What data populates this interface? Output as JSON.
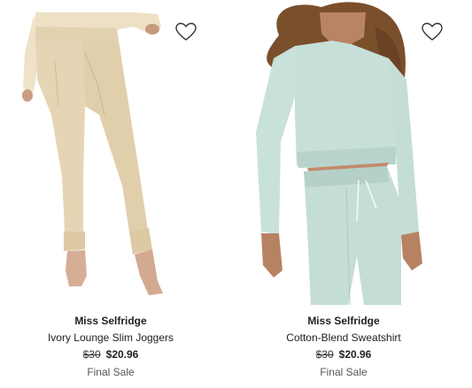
{
  "products": [
    {
      "brand": "Miss Selfridge",
      "name": "Ivory Lounge Slim Joggers",
      "original_price": "$30",
      "sale_price": "$20.96",
      "sale_note": "Final Sale",
      "image_icon": "model-wearing-beige-joggers",
      "wishlist_icon": "heart-outline-icon"
    },
    {
      "brand": "Miss Selfridge",
      "name": "Cotton-Blend Sweatshirt",
      "original_price": "$30",
      "sale_price": "$20.96",
      "sale_note": "Final Sale",
      "image_icon": "model-wearing-mint-sweatshirt",
      "wishlist_icon": "heart-outline-icon"
    }
  ],
  "colors": {
    "background": "#ffffff",
    "text": "#222222",
    "muted_text": "#555555",
    "joggers_fabric": "#e8d8b8",
    "sweatshirt_fabric": "#c3dcd6"
  }
}
